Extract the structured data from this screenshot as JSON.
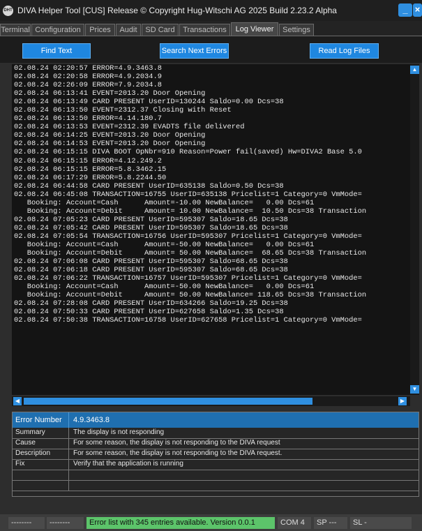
{
  "window": {
    "app_icon_text": "DHT",
    "title": "DIVA Helper Tool  [CUS]  Release © Copyright Hug-Witschi AG 2025 Build 2.23.2 Alpha",
    "minimize_label": "_",
    "close_label": "×"
  },
  "tabs": [
    "Terminal",
    "Configuration",
    "Prices",
    "Audit",
    "SD Card",
    "Transactions",
    "Log Viewer",
    "Settings"
  ],
  "active_tab": "Log Viewer",
  "toolbar": {
    "find_text": "Find Text",
    "search_next_errors": "Search Next Errors",
    "read_log_files": "Read Log Files"
  },
  "log_lines": [
    "02.08.24 02:20:57 ERROR=4.9.3463.8",
    "02.08.24 02:20:58 ERROR=4.9.2034.9",
    "02.08.24 02:26:09 ERROR=7.9.2034.8",
    "02.08.24 06:13:41 EVENT=2013.20 Door Opening",
    "02.08.24 06:13:49 CARD PRESENT UserID=130244 Saldo=0.00 Dcs=38",
    "02.08.24 06:13:50 EVENT=2312.37 Closing with Reset",
    "02.08.24 06:13:50 ERROR=4.14.180.7",
    "02.08.24 06:13:53 EVENT=2312.39 EVADTS file delivered",
    "02.08.24 06:14:25 EVENT=2013.20 Door Opening",
    "02.08.24 06:14:53 EVENT=2013.20 Door Opening",
    "02.08.24 06:15:15 DIVA BOOT OpNbr=910 Reason=Power fail(saved) Hw=DIVA2 Base 5.0",
    "02.08.24 06:15:15 ERROR=4.12.249.2",
    "02.08.24 06:15:15 ERROR=5.8.3462.15",
    "02.08.24 06:17:29 ERROR=5.8.2244.50",
    "02.08.24 06:44:58 CARD PRESENT UserID=635138 Saldo=0.50 Dcs=38",
    "02.08.24 06:45:08 TRANSACTION=16755 UserID=635138 Pricelist=1 Category=0 VmMode=",
    "   Booking: Account=Cash      Amount=-10.00 NewBalance=   0.00 Dcs=61",
    "   Booking: Account=Debit     Amount= 10.00 NewBalance=  10.50 Dcs=38 Transaction",
    "02.08.24 07:05:23 CARD PRESENT UserID=595307 Saldo=18.65 Dcs=38",
    "02.08.24 07:05:42 CARD PRESENT UserID=595307 Saldo=18.65 Dcs=38",
    "02.08.24 07:05:54 TRANSACTION=16756 UserID=595307 Pricelist=1 Category=0 VmMode=",
    "   Booking: Account=Cash      Amount=-50.00 NewBalance=   0.00 Dcs=61",
    "   Booking: Account=Debit     Amount= 50.00 NewBalance=  68.65 Dcs=38 Transaction",
    "02.08.24 07:06:08 CARD PRESENT UserID=595307 Saldo=68.65 Dcs=38",
    "02.08.24 07:06:18 CARD PRESENT UserID=595307 Saldo=68.65 Dcs=38",
    "02.08.24 07:06:22 TRANSACTION=16757 UserID=595307 Pricelist=1 Category=0 VmMode=",
    "   Booking: Account=Cash      Amount=-50.00 NewBalance=   0.00 Dcs=61",
    "   Booking: Account=Debit     Amount= 50.00 NewBalance= 118.65 Dcs=38 Transaction",
    "02.08.24 07:28:08 CARD PRESENT UserID=634266 Saldo=19.25 Dcs=38",
    "02.08.24 07:50:33 CARD PRESENT UserID=627658 Saldo=1.35 Dcs=38",
    "02.08.24 07:50:38 TRANSACTION=16758 UserID=627658 Pricelist=1 Category=0 VmMode="
  ],
  "error_detail": {
    "header_label": "Error Number",
    "header_value": "4.9.3463.8",
    "rows": [
      {
        "key": "Summary",
        "value": "The display is not responding"
      },
      {
        "key": "Cause",
        "value": "For some reason, the display is not responding to the DIVA request"
      },
      {
        "key": "Description",
        "value": "For some reason, the display is not responding to the DIVA request."
      },
      {
        "key": "Fix",
        "value": "Verify that the application is running"
      },
      {
        "key": "",
        "value": ""
      },
      {
        "key": "",
        "value": ""
      }
    ]
  },
  "status_bar": {
    "seg1": "--------",
    "seg2": "--------",
    "message": "Error list with 345 entries available. Version 0.0.1",
    "port": "COM 4",
    "sp": "SP ---",
    "sl": "SL -"
  }
}
